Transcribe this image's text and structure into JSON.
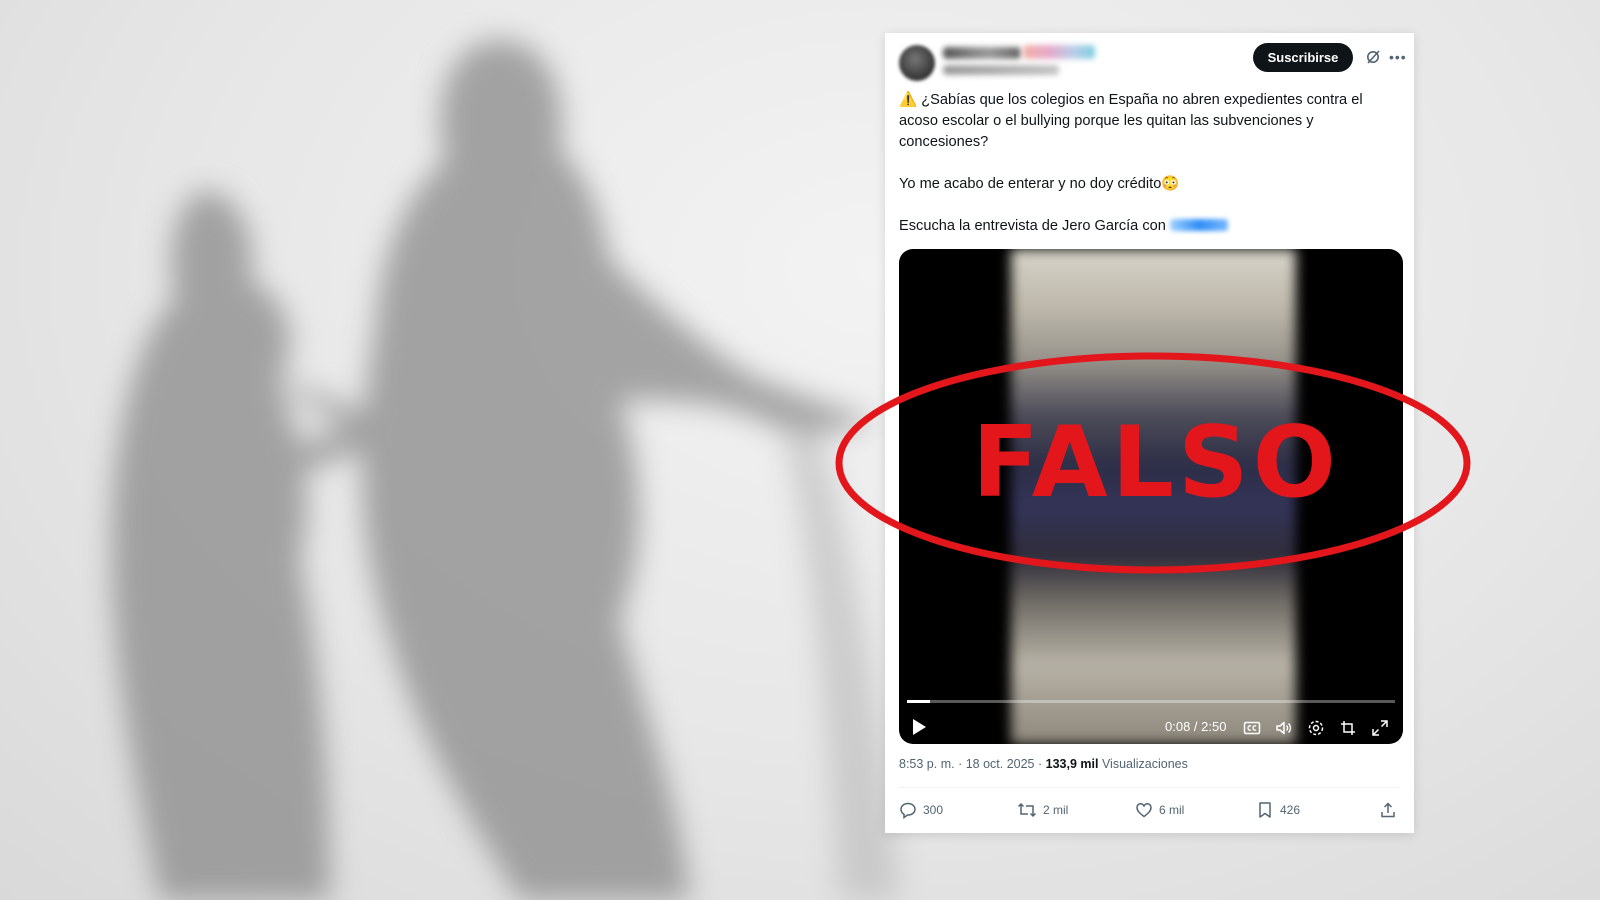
{
  "post": {
    "subscribe_label": "Suscribirse",
    "text_paragraphs": [
      "¿Sabías que los colegios en España no abren expedientes contra el acoso escolar o el bullying porque les quitan las subvenciones y concesiones?",
      "Yo me acabo de enterar y no doy crédito😳",
      "Escucha la entrevista de Jero García con"
    ],
    "warning_glyph": "⚠️",
    "video": {
      "time_label": "0:08 / 2:50",
      "progress_fraction": 0.047
    },
    "meta": {
      "time": "8:53 p. m.",
      "date": "18 oct. 2025",
      "views_count": "133,9 mil",
      "views_label": "Visualizaciones"
    },
    "actions": {
      "replies": "300",
      "reposts": "2 mil",
      "likes": "6 mil",
      "bookmarks": "426"
    }
  },
  "overlay": {
    "stamp_text": "FALSO",
    "stamp_color": "#e3161b"
  },
  "icons": [
    "more-icon",
    "grok-icon",
    "play-icon",
    "captions-icon",
    "volume-icon",
    "settings-icon",
    "pip-icon",
    "fullscreen-icon",
    "reply-icon",
    "repost-icon",
    "like-icon",
    "bookmark-icon",
    "share-icon"
  ]
}
